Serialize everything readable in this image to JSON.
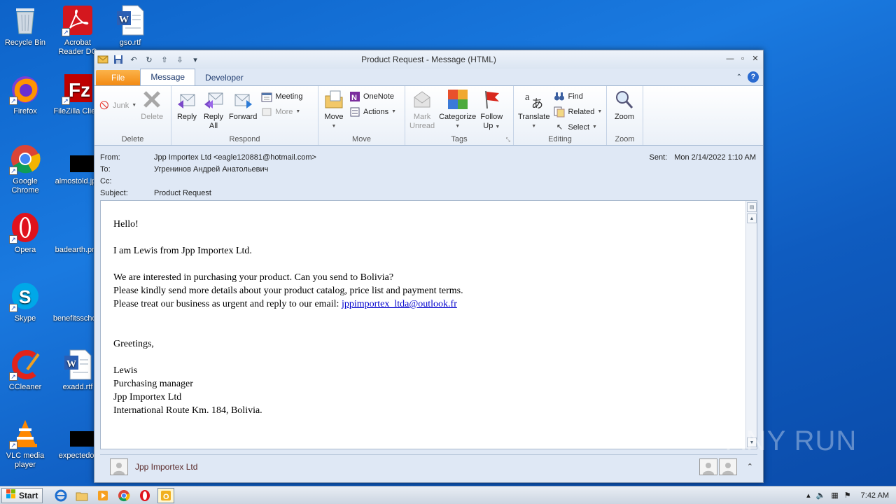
{
  "desktop": {
    "icons": [
      {
        "label": "Recycle Bin"
      },
      {
        "label": "Acrobat Reader DC"
      },
      {
        "label": "gso.rtf"
      },
      {
        "label": "Firefox"
      },
      {
        "label": "FileZilla Client"
      },
      {
        "label": "Google Chrome"
      },
      {
        "label": "almostold.jpg"
      },
      {
        "label": "Opera"
      },
      {
        "label": "badearth.png"
      },
      {
        "label": "Skype"
      },
      {
        "label": "benefitsschool"
      },
      {
        "label": "CCleaner"
      },
      {
        "label": "exadd.rtf"
      },
      {
        "label": "VLC media player"
      },
      {
        "label": "expectedor"
      }
    ]
  },
  "window": {
    "title": "Product Request - Message (HTML)"
  },
  "tabs": {
    "file": "File",
    "message": "Message",
    "developer": "Developer"
  },
  "ribbon": {
    "delete_group": {
      "label": "Delete",
      "junk": "Junk",
      "delete": "Delete"
    },
    "respond_group": {
      "label": "Respond",
      "reply": "Reply",
      "reply_all_1": "Reply",
      "reply_all_2": "All",
      "forward": "Forward",
      "meeting": "Meeting",
      "more": "More"
    },
    "move_group": {
      "label": "Move",
      "move": "Move",
      "onenote": "OneNote",
      "actions": "Actions"
    },
    "tags_group": {
      "label": "Tags",
      "mark_unread_1": "Mark",
      "mark_unread_2": "Unread",
      "categorize": "Categorize",
      "follow_up_1": "Follow",
      "follow_up_2": "Up"
    },
    "editing_group": {
      "label": "Editing",
      "translate": "Translate",
      "find": "Find",
      "related": "Related",
      "select": "Select"
    },
    "zoom_group": {
      "label": "Zoom",
      "zoom": "Zoom"
    }
  },
  "headers": {
    "from_label": "From:",
    "from_value": "Jpp Importex Ltd <eagle120881@hotmail.com>",
    "to_label": "To:",
    "to_value": "Угренинов Андрей Анатольевич",
    "cc_label": "Cc:",
    "cc_value": "",
    "subject_label": "Subject:",
    "subject_value": "Product Request",
    "sent_label": "Sent:",
    "sent_value": "Mon 2/14/2022 1:10 AM"
  },
  "body": {
    "greeting": "Hello!",
    "intro": "I am Lewis from Jpp Importex Ltd.",
    "line1": "We are interested in purchasing your product. Can you send to Bolivia?",
    "line2": "Please kindly send more details about your product catalog, price list and payment terms.",
    "line3_prefix": "Please treat our business as urgent and reply to our email: ",
    "email_link": "jppimportex_ltda@outlook.fr",
    "closing": "Greetings,",
    "sig_name": "Lewis",
    "sig_title": "Purchasing manager",
    "sig_company": "Jpp Importex Ltd",
    "sig_address": "International Route Km. 184, Bolivia."
  },
  "people_pane": {
    "name": "Jpp Importex Ltd"
  },
  "taskbar": {
    "start": "Start",
    "clock": "7:42 AM"
  },
  "watermark": "ANY RUN"
}
